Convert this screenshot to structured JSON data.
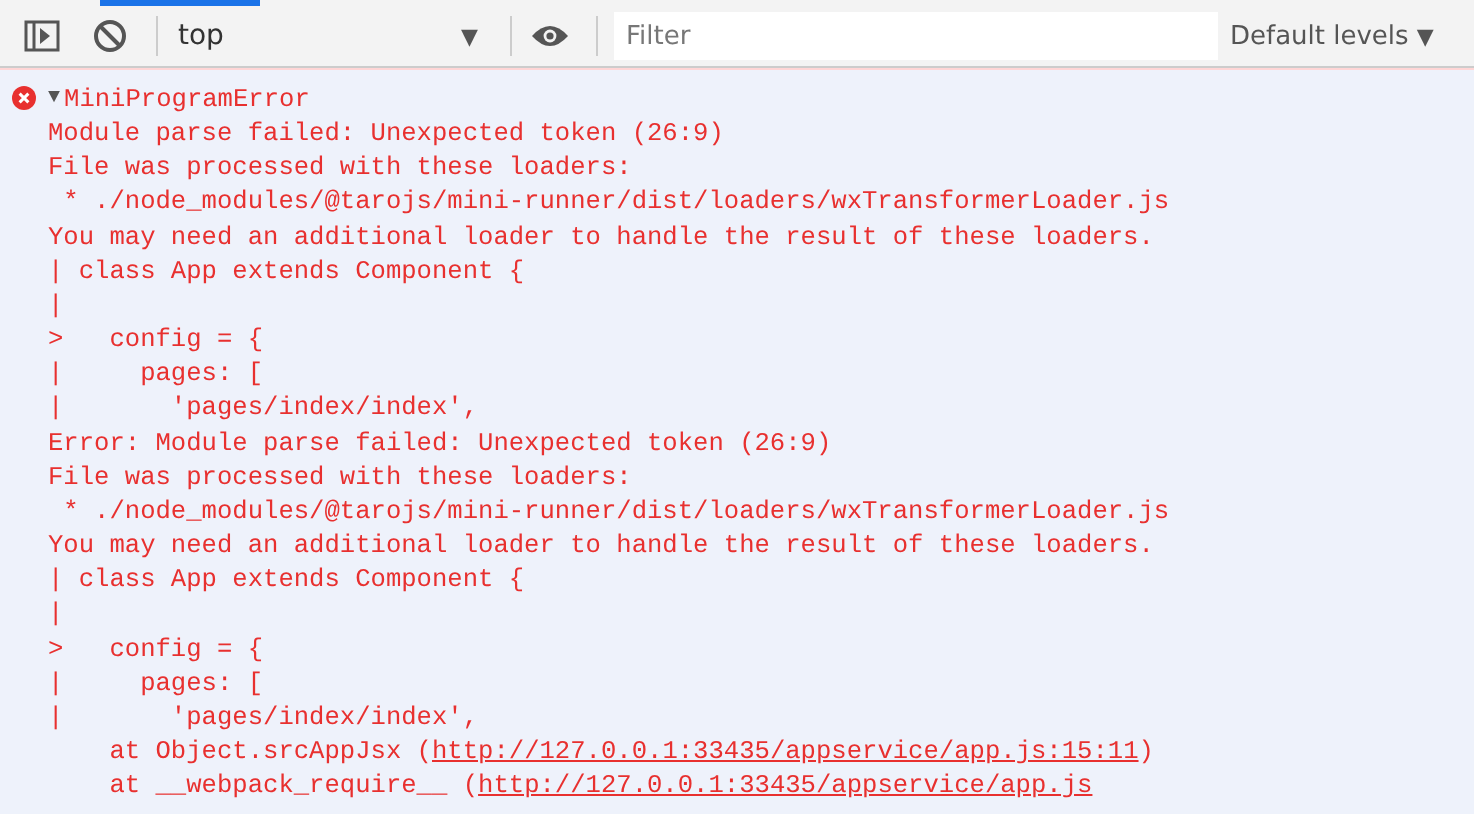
{
  "toolbar": {
    "context": "top",
    "context_caret": "▼",
    "filter": {
      "placeholder": "Filter"
    },
    "levels": "Default levels",
    "levels_caret": "▼"
  },
  "message": {
    "expanded": true,
    "disclosure": "▼",
    "title": "MiniProgramError",
    "lines": [
      {
        "kind": "text",
        "text": "Module parse failed: Unexpected token (26:9)"
      },
      {
        "kind": "text",
        "text": "File was processed with these loaders:"
      },
      {
        "kind": "text",
        "text": " * ./node_modules/@tarojs/mini-runner/dist/loaders/wxTransformerLoader.js"
      },
      {
        "kind": "text",
        "text": "You may need an additional loader to handle the result of these loaders."
      },
      {
        "kind": "text",
        "text": "| class App extends Component {"
      },
      {
        "kind": "text",
        "text": "|"
      },
      {
        "kind": "text",
        "text": ">   config = {"
      },
      {
        "kind": "text",
        "text": "|     pages: ["
      },
      {
        "kind": "text",
        "text": "|       'pages/index/index',"
      },
      {
        "kind": "text",
        "text": "Error: Module parse failed: Unexpected token (26:9)"
      },
      {
        "kind": "text",
        "text": "File was processed with these loaders:"
      },
      {
        "kind": "text",
        "text": " * ./node_modules/@tarojs/mini-runner/dist/loaders/wxTransformerLoader.js"
      },
      {
        "kind": "text",
        "text": "You may need an additional loader to handle the result of these loaders."
      },
      {
        "kind": "text",
        "text": "| class App extends Component {"
      },
      {
        "kind": "text",
        "text": "|"
      },
      {
        "kind": "text",
        "text": ">   config = {"
      },
      {
        "kind": "text",
        "text": "|     pages: ["
      },
      {
        "kind": "text",
        "text": "|       'pages/index/index',"
      },
      {
        "kind": "stack",
        "prefix": "    at Object.srcAppJsx (",
        "link": "http://127.0.0.1:33435/appservice/app.js:15:11",
        "suffix": ")"
      },
      {
        "kind": "stack",
        "prefix": "    at __webpack_require__ (",
        "link": "http://127.0.0.1:33435/appservice/app.js"
      }
    ]
  }
}
